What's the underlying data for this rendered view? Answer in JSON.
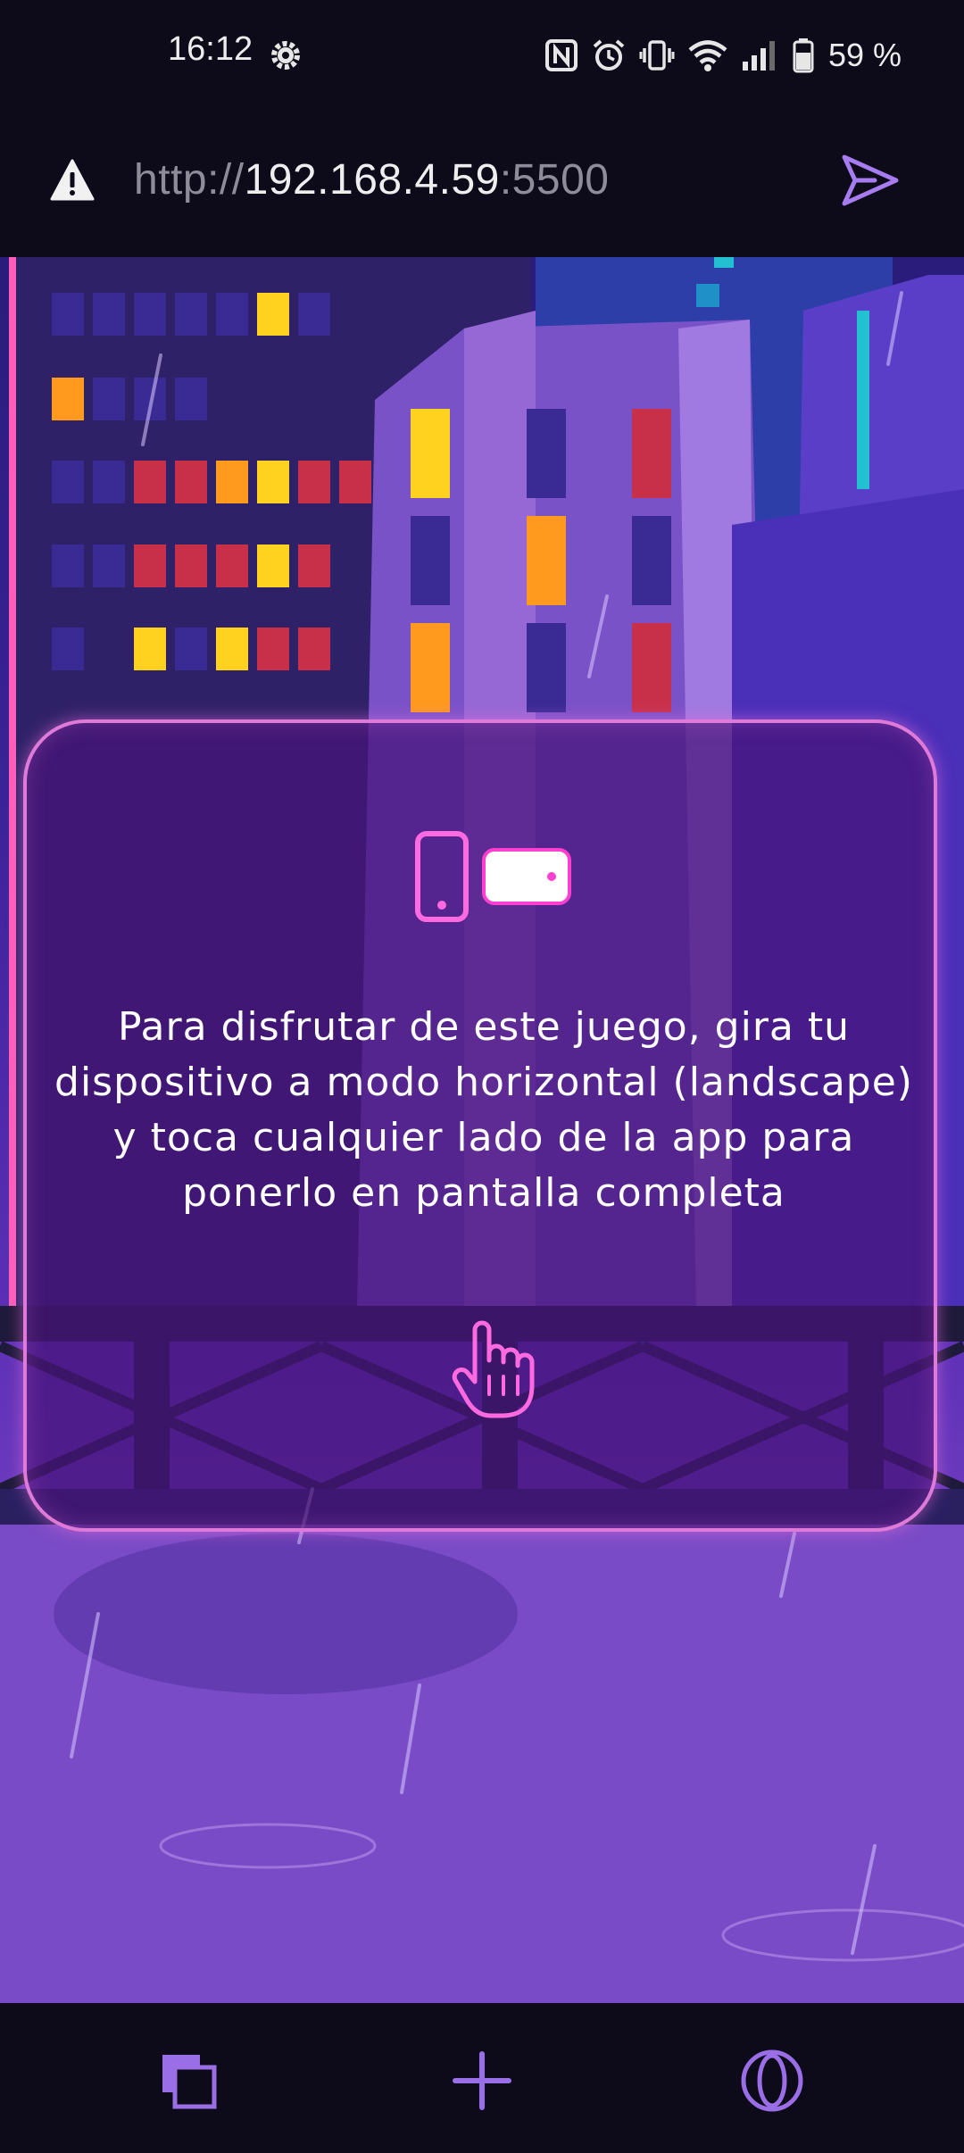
{
  "status_bar": {
    "time": "16:12",
    "battery": "59 %",
    "icons": [
      "gear-icon",
      "nfc-icon",
      "alarm-icon",
      "vibrate-icon",
      "wifi-icon",
      "signal-icon",
      "battery-icon"
    ]
  },
  "url_bar": {
    "scheme": "http://",
    "host": "192.168.4.59",
    "port": ":5500",
    "warning_icon": "warning-icon",
    "send_icon": "send-icon"
  },
  "overlay": {
    "message": "Para disfrutar de este juego, gira tu dispositivo a modo horizontal (landscape) y toca cualquier lado de la app para ponerlo en pantalla completa",
    "icons": [
      "phone-portrait-icon",
      "phone-landscape-icon",
      "tap-hand-icon"
    ]
  },
  "bottom_nav": {
    "icons": [
      "tabs-icon",
      "new-tab-icon",
      "opera-icon"
    ]
  },
  "colors": {
    "accent": "#a77cf0",
    "neon_pink": "#ff4fd8",
    "card_border": "#e07ad8",
    "bar_bg": "#0d0a1a"
  }
}
